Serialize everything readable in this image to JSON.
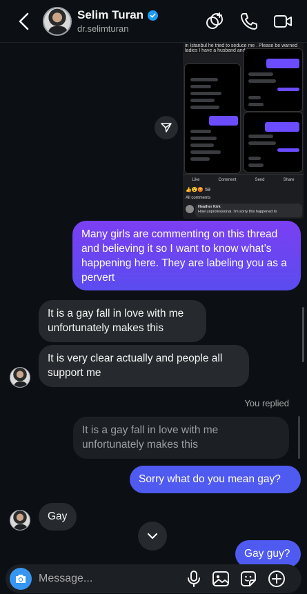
{
  "header": {
    "name": "Selim Turan",
    "username": "dr.selimturan",
    "icons": [
      "back-arrow-icon",
      "verified-badge-icon",
      "add-video-effect-icon",
      "phone-icon",
      "video-camera-icon"
    ]
  },
  "shared_post": {
    "caption_top": "in Istanbul he tried to seduce me . Please be warned ladies I have a husband and i felt very scared",
    "actions": [
      "Like",
      "Comment",
      "Send",
      "Share"
    ],
    "reaction_count": "59",
    "all_comments": "All comments",
    "commenter": "Heather Kirk",
    "comment_text": "How unprofessional. I'm sorry this happened to"
  },
  "messages": [
    {
      "id": "m1",
      "text": "Many girls are commenting on this thread and believing it so I want to know what’s happening here. They are labeling you as a pervert"
    },
    {
      "id": "m2",
      "text": "It is a gay fall in love with me unfortunately makes this"
    },
    {
      "id": "m3",
      "text": "It is very clear actually and people all support me"
    },
    {
      "id": "m4_label",
      "text": "You replied"
    },
    {
      "id": "m4_quote",
      "text": "It is a gay fall in love with me unfortunately makes this"
    },
    {
      "id": "m5",
      "text": "Sorry what do you mean gay?"
    },
    {
      "id": "m6",
      "text": "Gay"
    },
    {
      "id": "m7",
      "text": "Gay guy?"
    }
  ],
  "composer": {
    "placeholder": "Message...",
    "icons": [
      "camera-icon",
      "microphone-icon",
      "gallery-icon",
      "sticker-icon",
      "plus-icon"
    ]
  },
  "colors": {
    "background": "#0c1014",
    "incoming": "#262a2e",
    "outgoing_purple": "#7b3ff2",
    "outgoing_blue": "#4f5af0",
    "accent": "#3797f0"
  }
}
